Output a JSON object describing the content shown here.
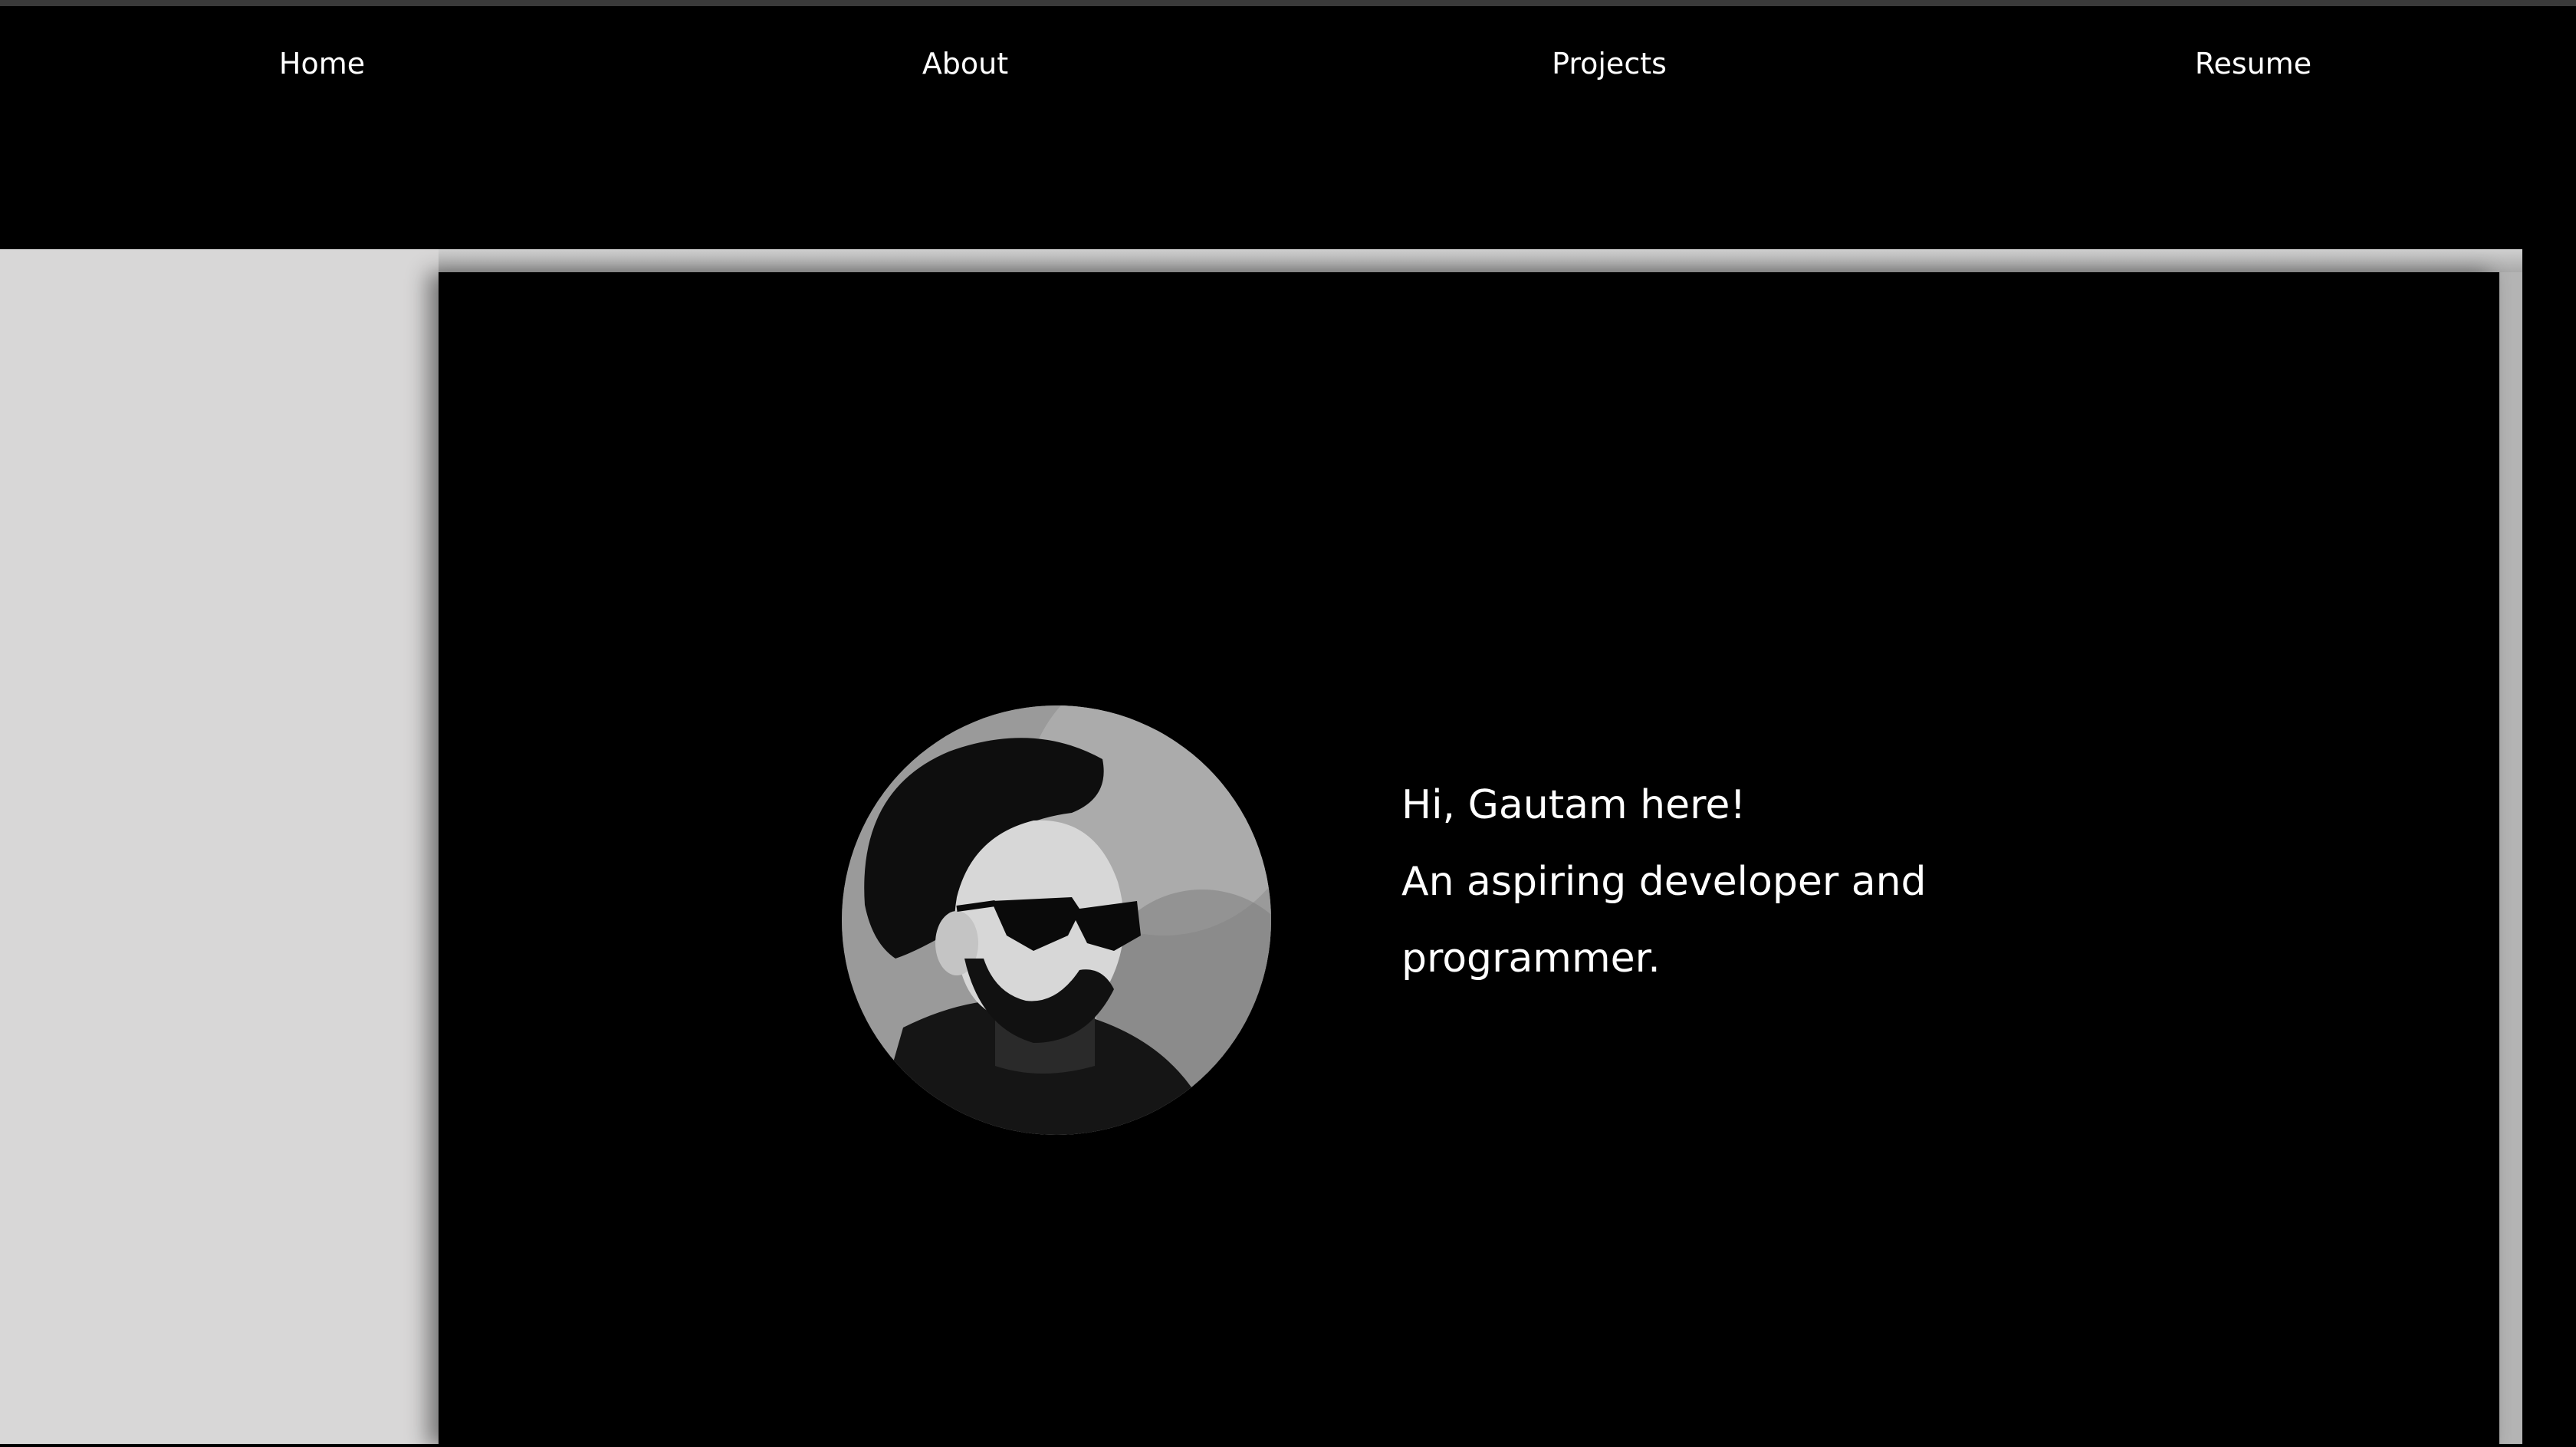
{
  "nav": {
    "items": [
      {
        "label": "Home"
      },
      {
        "label": "About"
      },
      {
        "label": "Projects"
      },
      {
        "label": "Resume"
      }
    ]
  },
  "hero": {
    "greeting": "Hi, Gautam here!",
    "line2": "An aspiring developer and",
    "line3": "programmer.",
    "avatar_icon": "profile-photo"
  },
  "colors": {
    "page_background": "#000000",
    "content_background": "#d8d7d7",
    "text": "#ffffff"
  }
}
